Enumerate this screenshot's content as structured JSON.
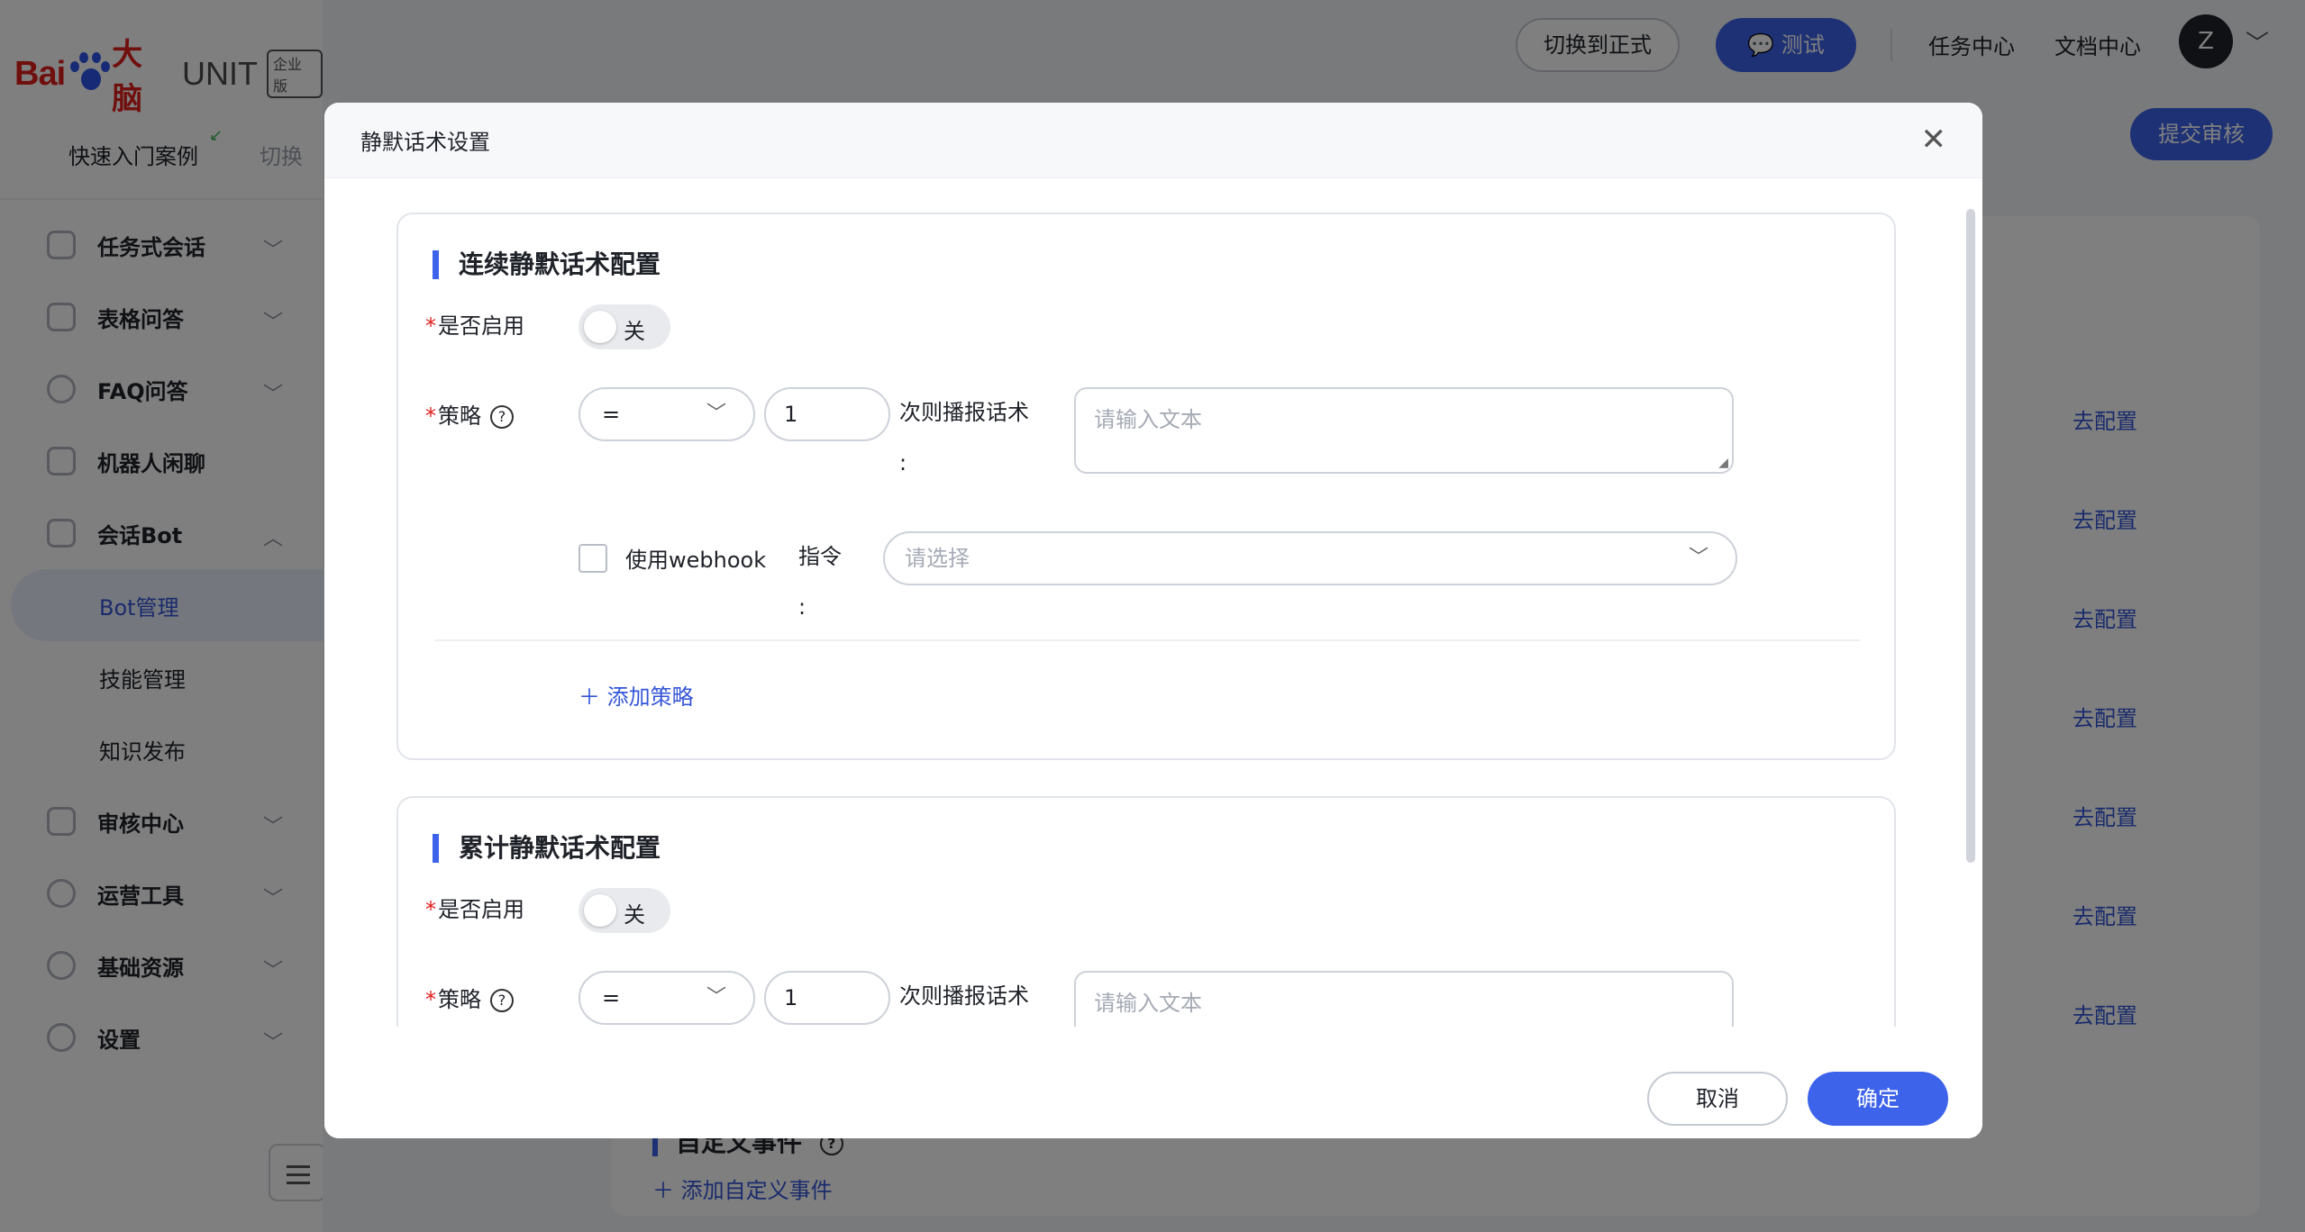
{
  "app": {
    "logo_bai": "Bai",
    "logo_dn": "大脑",
    "logo_unit": "UNIT",
    "logo_edition": "企业版",
    "quick_start": "快速入门案例",
    "switch": "切换"
  },
  "sidebar": {
    "items": [
      {
        "label": "任务式会话",
        "icon": "task-icon"
      },
      {
        "label": "表格问答",
        "icon": "table-icon"
      },
      {
        "label": "FAQ问答",
        "icon": "faq-icon"
      },
      {
        "label": "机器人闲聊",
        "icon": "chat-icon"
      },
      {
        "label": "会话Bot",
        "icon": "bot-icon"
      }
    ],
    "sub_items": [
      "Bot管理",
      "技能管理",
      "知识发布"
    ],
    "items_after": [
      {
        "label": "审核中心",
        "icon": "shield-icon"
      },
      {
        "label": "运营工具",
        "icon": "tool-icon"
      },
      {
        "label": "基础资源",
        "icon": "resource-icon"
      },
      {
        "label": "设置",
        "icon": "gear-icon"
      }
    ]
  },
  "header": {
    "switch_formal": "切换到正式",
    "test": "测试",
    "task_center": "任务中心",
    "doc_center": "文档中心",
    "avatar": "Z",
    "submit_review": "提交审核"
  },
  "background": {
    "configure_label": "去配置",
    "custom_event": "自定义事件",
    "add_custom_event": "添加自定义事件"
  },
  "modal": {
    "title": "静默话术设置",
    "sections": [
      {
        "title": "连续静默话术配置",
        "enable_label": "是否启用",
        "toggle_text": "关",
        "strategy_label": "策略",
        "operator": "=",
        "count": "1",
        "strategy_suffix": "次则播报话术",
        "colon": ":",
        "text_placeholder": "请输入文本",
        "webhook_label": "使用webhook",
        "command_label": "指令",
        "command_placeholder": "请选择",
        "add_strategy": "添加策略"
      },
      {
        "title": "累计静默话术配置",
        "enable_label": "是否启用",
        "toggle_text": "关",
        "strategy_label": "策略",
        "operator": "=",
        "count": "1",
        "strategy_suffix": "次则播报话术",
        "text_placeholder": "请输入文本"
      }
    ],
    "cancel": "取消",
    "confirm": "确定"
  },
  "colors": {
    "primary": "#3d63ea",
    "required": "#e0201c",
    "link": "#3556d8"
  }
}
